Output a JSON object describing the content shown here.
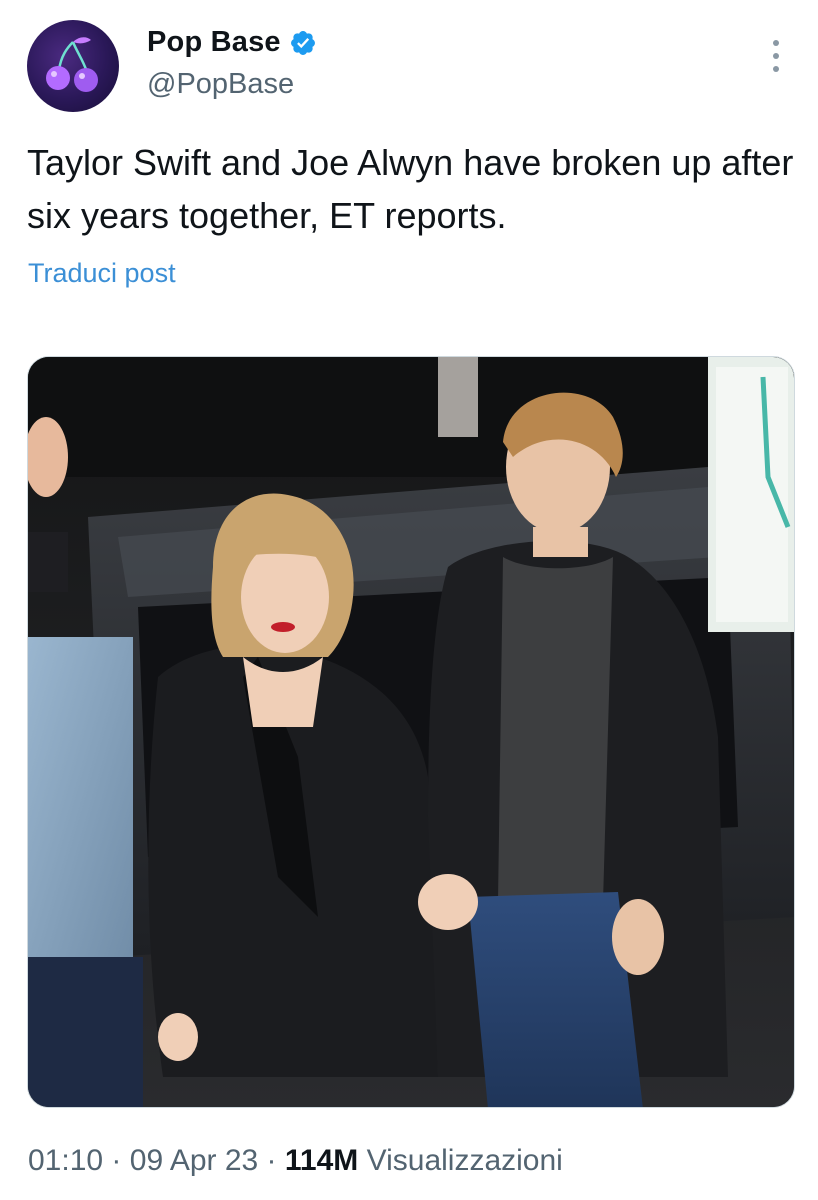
{
  "author": {
    "display_name": "Pop Base",
    "handle": "@PopBase",
    "verified": true,
    "avatar_icon": "cherry-icon"
  },
  "tweet": {
    "text": "Taylor Swift and Joe Alwyn have broken up after six years together, ET reports.",
    "translate_label": "Traduci post"
  },
  "media": {
    "kind": "photo"
  },
  "meta": {
    "time": "01:10",
    "separator": "·",
    "date": "09 Apr 23",
    "views_count": "114M",
    "views_label": "Visualizzazioni"
  },
  "colors": {
    "link": "#3b8fd6",
    "verified": "#1d9bf0",
    "secondary_text": "#536471"
  }
}
